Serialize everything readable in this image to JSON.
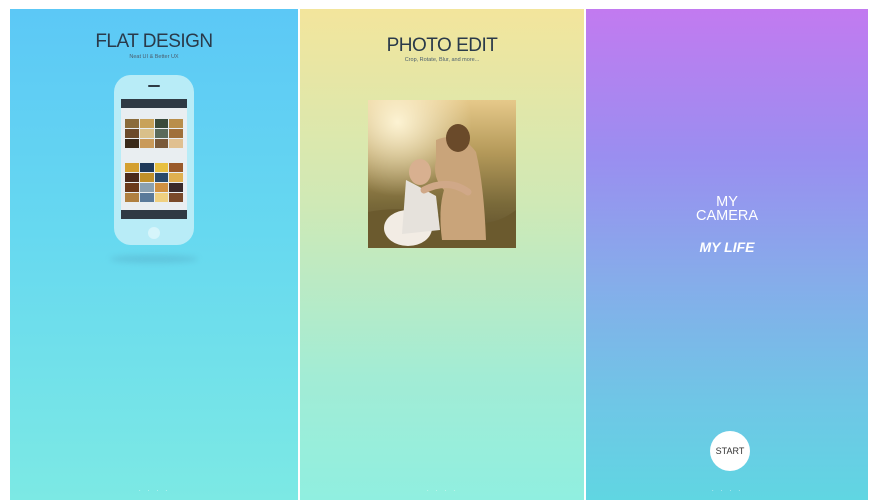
{
  "panels": {
    "flat": {
      "title": "FLAT DESIGN",
      "subtitle": "Neat UI & Better UX"
    },
    "photo": {
      "title": "PHOTO EDIT",
      "subtitle": "Crop, Rotate, Blur, and more..."
    },
    "camera": {
      "line1": "MY",
      "line2": "CAMERA",
      "line3": "MY LIFE",
      "start_label": "START"
    }
  },
  "colors": {
    "panel1": "#5cc8f6",
    "panel2": "#f3e59c",
    "panel3": "#c27af0",
    "title_text": "#2a3a4a"
  }
}
